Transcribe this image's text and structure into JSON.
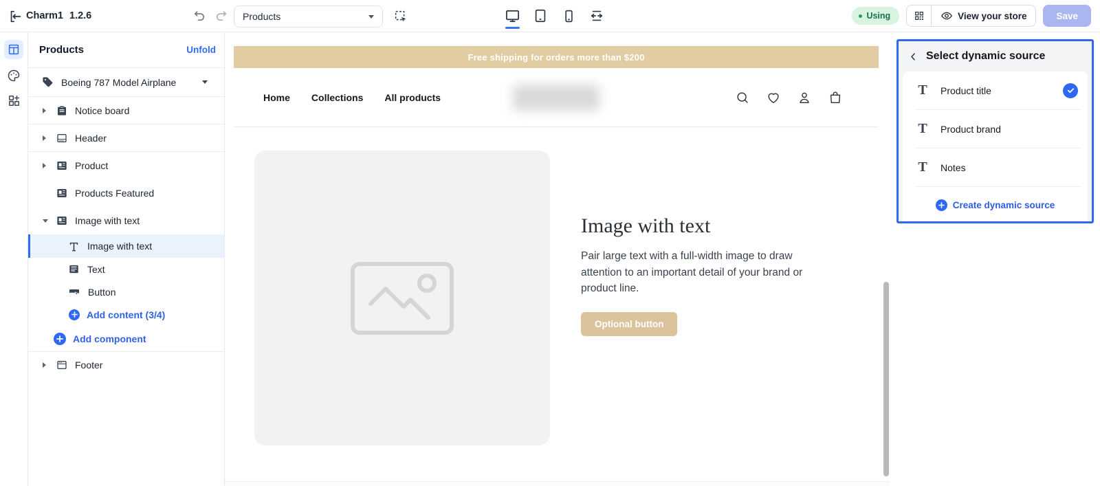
{
  "topbar": {
    "app_name": "Charm1",
    "version": "1.2.6",
    "page_selector_value": "Products",
    "using_badge": "Using",
    "view_store_label": "View your store",
    "save_label": "Save",
    "accent_color": "#2f6bf6"
  },
  "sidebar": {
    "panel_title": "Products",
    "unfold_label": "Unfold",
    "product_picker": "Boeing 787 Model Airplane",
    "items": {
      "notice_board": "Notice board",
      "header": "Header",
      "product": "Product",
      "products_featured": "Products Featured",
      "image_with_text": "Image with text",
      "footer": "Footer"
    },
    "children": {
      "image_with_text": "Image with text",
      "text": "Text",
      "button": "Button"
    },
    "add_content_label": "Add content (3/4)",
    "add_component_label": "Add component"
  },
  "canvas": {
    "announcement": "Free shipping for orders more than $200",
    "announcement_bg": "#e2cca2",
    "nav_links": [
      "Home",
      "Collections",
      "All products"
    ],
    "section": {
      "heading": "Image with text",
      "body": "Pair large text with a full-width image to draw attention to an important detail of your brand or product line.",
      "button_label": "Optional button",
      "button_bg": "#dbc49c"
    }
  },
  "panel": {
    "title": "Select dynamic source",
    "items": [
      {
        "label": "Product title",
        "selected": true
      },
      {
        "label": "Product brand",
        "selected": false
      },
      {
        "label": "Notes",
        "selected": false
      }
    ],
    "create_label": "Create dynamic source"
  }
}
